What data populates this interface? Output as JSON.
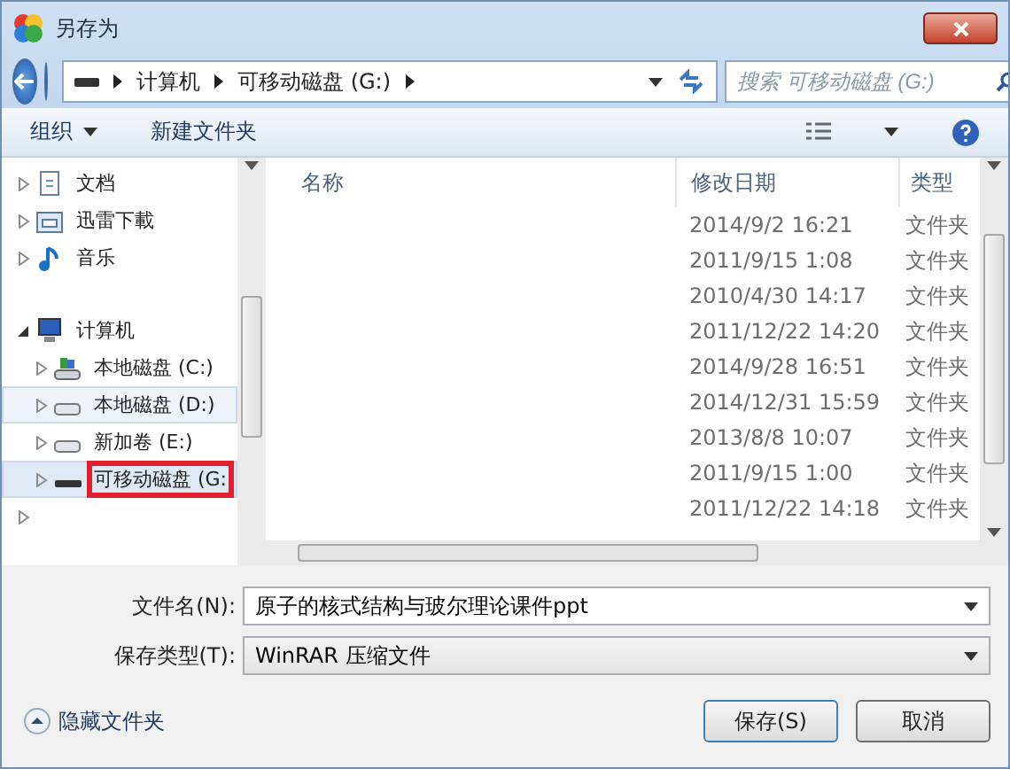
{
  "window": {
    "title": "另存为"
  },
  "address": {
    "path": [
      "计算机",
      "可移动磁盘 (G:)"
    ]
  },
  "search": {
    "placeholder": "搜索 可移动磁盘 (G:)"
  },
  "toolbar": {
    "organize": "组织",
    "new_folder": "新建文件夹"
  },
  "nav": [
    {
      "label": "文档",
      "kind": "document",
      "selected": false,
      "hover": false
    },
    {
      "label": "迅雷下載",
      "kind": "download",
      "selected": false,
      "hover": false
    },
    {
      "label": "音乐",
      "kind": "music",
      "selected": false,
      "hover": false
    },
    {
      "label": "计算机",
      "kind": "computer",
      "expanded": true,
      "selected": false,
      "hover": false,
      "children": [
        {
          "label": "本地磁盘 (C:)",
          "kind": "system-drive",
          "selected": false,
          "hover": false
        },
        {
          "label": "本地磁盘 (D:)",
          "kind": "drive",
          "selected": false,
          "hover": true
        },
        {
          "label": "新加卷 (E:)",
          "kind": "drive",
          "selected": false,
          "hover": false
        },
        {
          "label": "可移动磁盘 (G:",
          "kind": "removable",
          "selected": true,
          "hover": false,
          "marked": true
        }
      ]
    }
  ],
  "table": {
    "columns": [
      "名称",
      "修改日期",
      "类型"
    ],
    "rows": [
      {
        "modified": "2014/9/2 16:21",
        "type": "文件夹"
      },
      {
        "modified": "2011/9/15 1:08",
        "type": "文件夹"
      },
      {
        "modified": "2010/4/30 14:17",
        "type": "文件夹"
      },
      {
        "modified": "2011/12/22 14:20",
        "type": "文件夹"
      },
      {
        "modified": "2014/9/28 16:51",
        "type": "文件夹"
      },
      {
        "modified": "2014/12/31 15:59",
        "type": "文件夹"
      },
      {
        "modified": "2013/8/8 10:07",
        "type": "文件夹"
      },
      {
        "modified": "2011/9/15 1:00",
        "type": "文件夹"
      },
      {
        "modified": "2011/12/22 14:18",
        "type": "文件夹"
      }
    ]
  },
  "filename": {
    "label": "文件名(N):",
    "value": "原子的核式结构与玻尔理论课件ppt"
  },
  "filetype": {
    "label": "保存类型(T):",
    "value": "WinRAR 压缩文件"
  },
  "hide_folders": "隐藏文件夹",
  "buttons": {
    "save": "保存(S)",
    "cancel": "取消"
  }
}
